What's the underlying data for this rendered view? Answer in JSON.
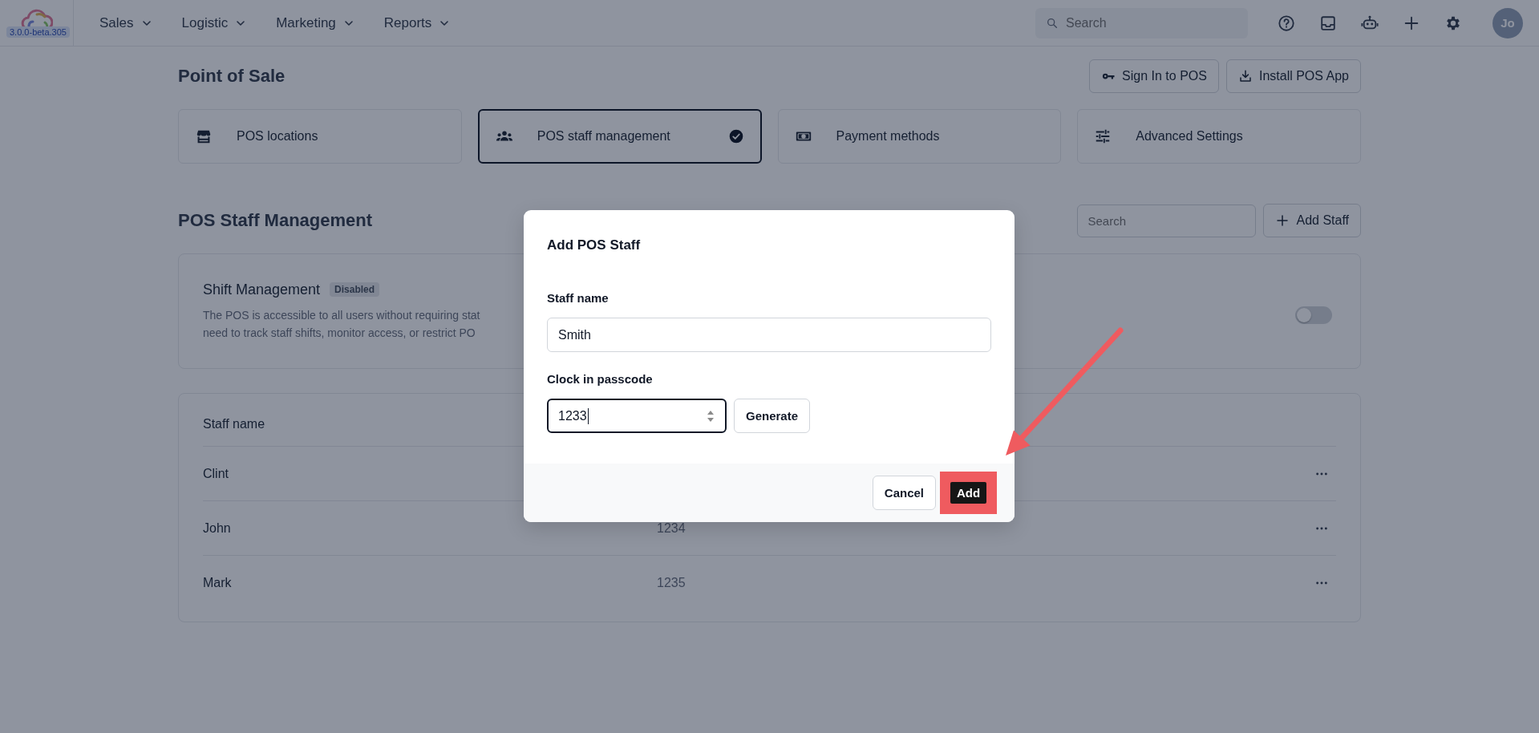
{
  "topbar": {
    "version": "3.0.0-beta.305",
    "nav": [
      {
        "label": "Sales"
      },
      {
        "label": "Logistic"
      },
      {
        "label": "Marketing"
      },
      {
        "label": "Reports"
      }
    ],
    "search": {
      "placeholder": "Search"
    },
    "avatar": "Jo"
  },
  "page": {
    "title": "Point of Sale",
    "actions": [
      {
        "label": "Sign In to POS",
        "kind": "key"
      },
      {
        "label": "Install POS App",
        "kind": "download"
      }
    ]
  },
  "sections": [
    {
      "label": "POS locations",
      "kind": "store",
      "selected": false
    },
    {
      "label": "POS staff management",
      "kind": "people",
      "selected": true
    },
    {
      "label": "Payment methods",
      "kind": "money",
      "selected": false
    },
    {
      "label": "Advanced Settings",
      "kind": "sliders",
      "selected": false
    }
  ],
  "staff": {
    "title": "POS Staff Management",
    "search": {
      "placeholder": "Search"
    },
    "add_label": "Add Staff",
    "shift": {
      "title": "Shift Management",
      "badge": "Disabled",
      "description_lines": [
        "The POS is accessible to all users without requiring stat",
        "need to track staff shifts, monitor access, or restrict PO"
      ],
      "on": false
    },
    "table": {
      "columns": [
        "Staff name"
      ],
      "rows": [
        {
          "name": "Clint"
        },
        {
          "name": "John",
          "passcode": "1234"
        },
        {
          "name": "Mark",
          "passcode": "1235"
        }
      ]
    }
  },
  "dialog": {
    "title": "Add POS Staff",
    "fields": [
      {
        "label": "Staff name",
        "value": "Smith",
        "kind": "text",
        "focused": false
      },
      {
        "label": "Clock in passcode",
        "value": "1233",
        "kind": "number",
        "focused": true,
        "action": "Generate"
      }
    ],
    "buttons": [
      {
        "label": "Cancel",
        "kind": "secondary",
        "highlighted": false
      },
      {
        "label": "Add",
        "kind": "primary",
        "highlighted": true
      }
    ]
  }
}
